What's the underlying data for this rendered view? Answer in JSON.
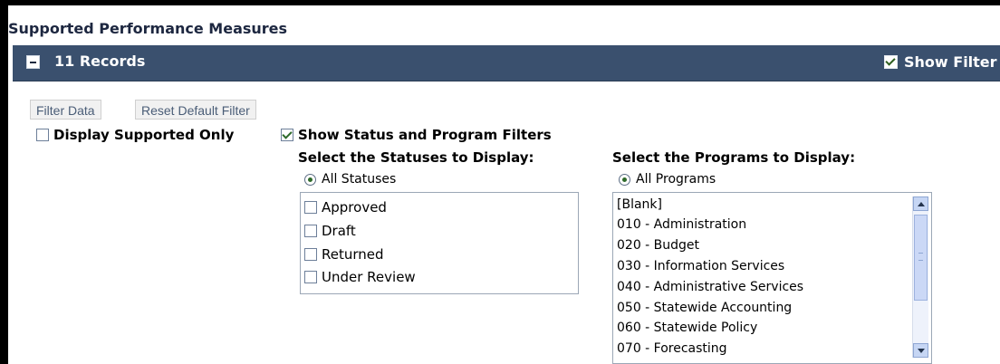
{
  "section": {
    "title": "Supported Performance Measures"
  },
  "records_bar": {
    "collapse_icon": "minus-square-icon",
    "records_label": "11 Records",
    "show_filter_label": "Show Filter",
    "show_filter_checked": true
  },
  "buttons": {
    "filter_data": "Filter Data",
    "reset_default_filter": "Reset Default Filter"
  },
  "options": {
    "display_supported_only": {
      "label": "Display Supported Only",
      "checked": false
    },
    "show_status_program_filters": {
      "label": "Show Status and Program Filters",
      "checked": true
    }
  },
  "statuses": {
    "heading": "Select the Statuses to Display:",
    "all_label": "All Statuses",
    "all_selected": true,
    "items": [
      {
        "label": "Approved",
        "checked": false
      },
      {
        "label": "Draft",
        "checked": false
      },
      {
        "label": "Returned",
        "checked": false
      },
      {
        "label": "Under Review",
        "checked": false
      }
    ]
  },
  "programs": {
    "heading": "Select the Programs to Display:",
    "all_label": "All Programs",
    "all_selected": true,
    "items": [
      "[Blank]",
      "010 - Administration",
      "020 - Budget",
      "030 - Information Services",
      "040 - Administrative Services",
      "050 - Statewide Accounting",
      "060 - Statewide Policy",
      "070 - Forecasting"
    ]
  },
  "colors": {
    "header_bar": "#3a506e",
    "check_green": "#2e6a2a",
    "button_text": "#4a5d77"
  }
}
